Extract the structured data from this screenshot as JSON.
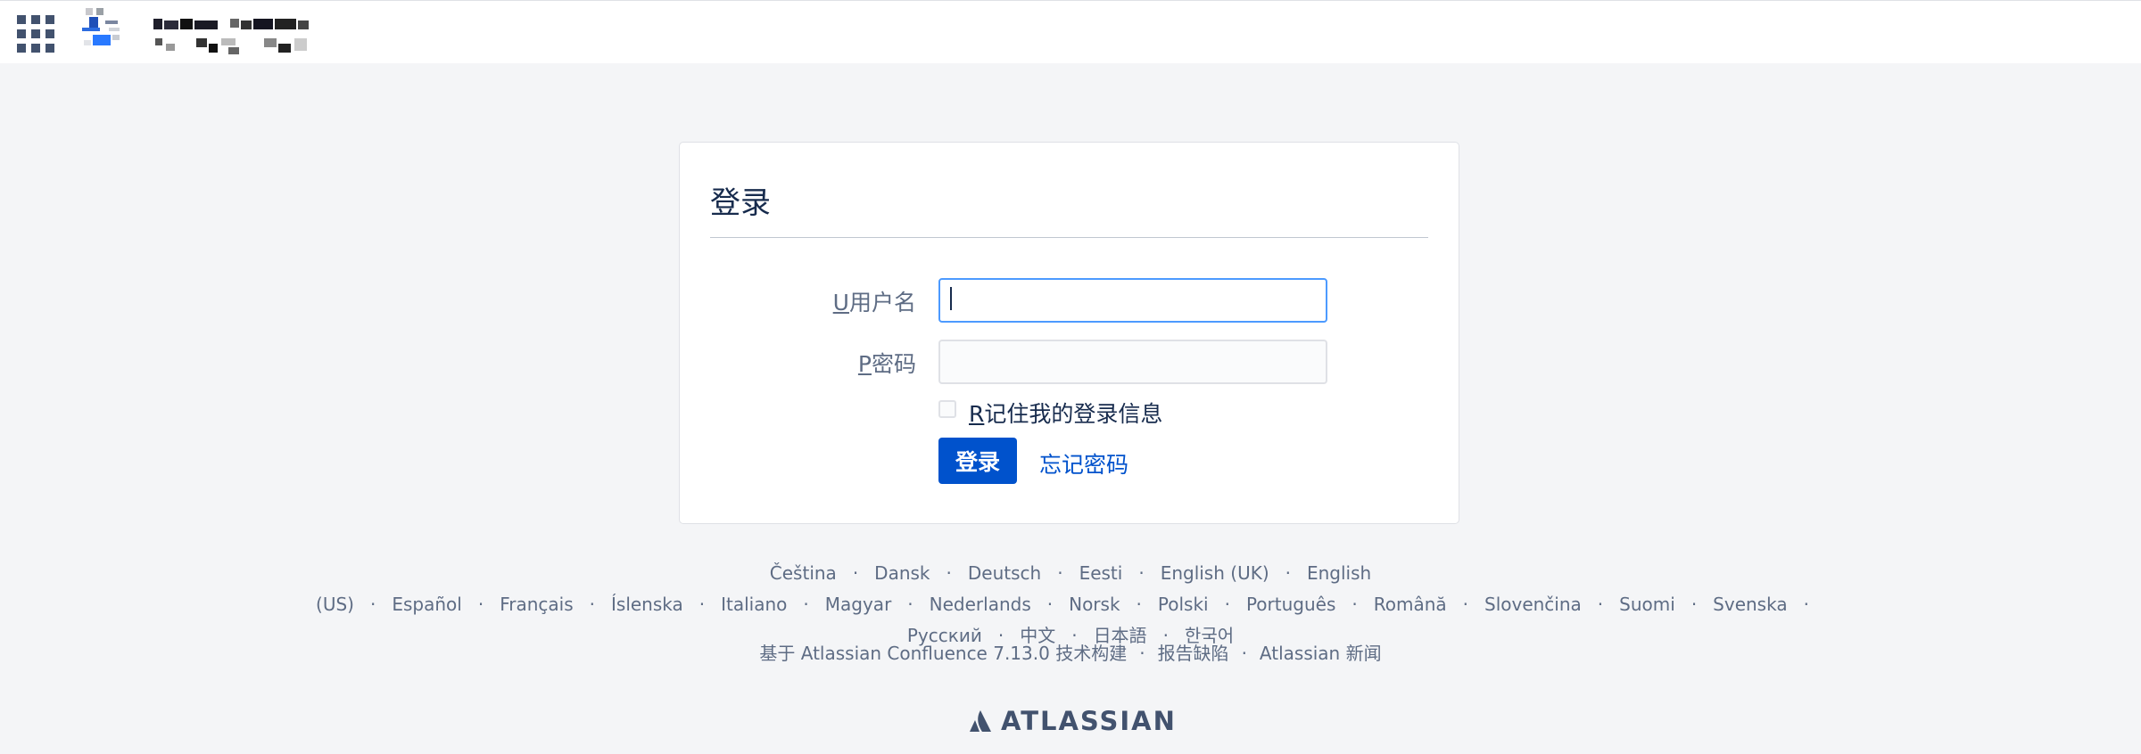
{
  "header": {
    "app_switcher_icon": "grid-icon",
    "site_logo_icon": "site-logo-icon"
  },
  "login": {
    "title": "登录",
    "username_accesskey": "U",
    "username_label": "用户名",
    "username_value": "",
    "password_accesskey": "P",
    "password_label": "密码",
    "password_value": "",
    "remember_accesskey": "R",
    "remember_label": "记住我的登录信息",
    "remember_checked": false,
    "submit_label": "登录",
    "forgot_label": "忘记密码"
  },
  "languages": [
    "Čeština",
    "Dansk",
    "Deutsch",
    "Eesti",
    "English (UK)",
    "English (US)",
    "Español",
    "Français",
    "Íslenska",
    "Italiano",
    "Magyar",
    "Nederlands",
    "Norsk",
    "Polski",
    "Português",
    "Română",
    "Slovenčina",
    "Suomi",
    "Svenska",
    "Русский",
    "中文",
    "日本語",
    "한국어"
  ],
  "footer": {
    "powered_by": "基于 Atlassian Confluence 7.13.0 技术构建",
    "report_bug": "报告缺陷",
    "atlassian_news": "Atlassian 新闻",
    "atlassian_logo_text": "ATLASSIAN"
  },
  "colors": {
    "primary": "#0052cc",
    "focus_border": "#4c9aff",
    "text": "#172b4d",
    "muted_text": "#5e6c84",
    "background": "#f4f5f7"
  }
}
